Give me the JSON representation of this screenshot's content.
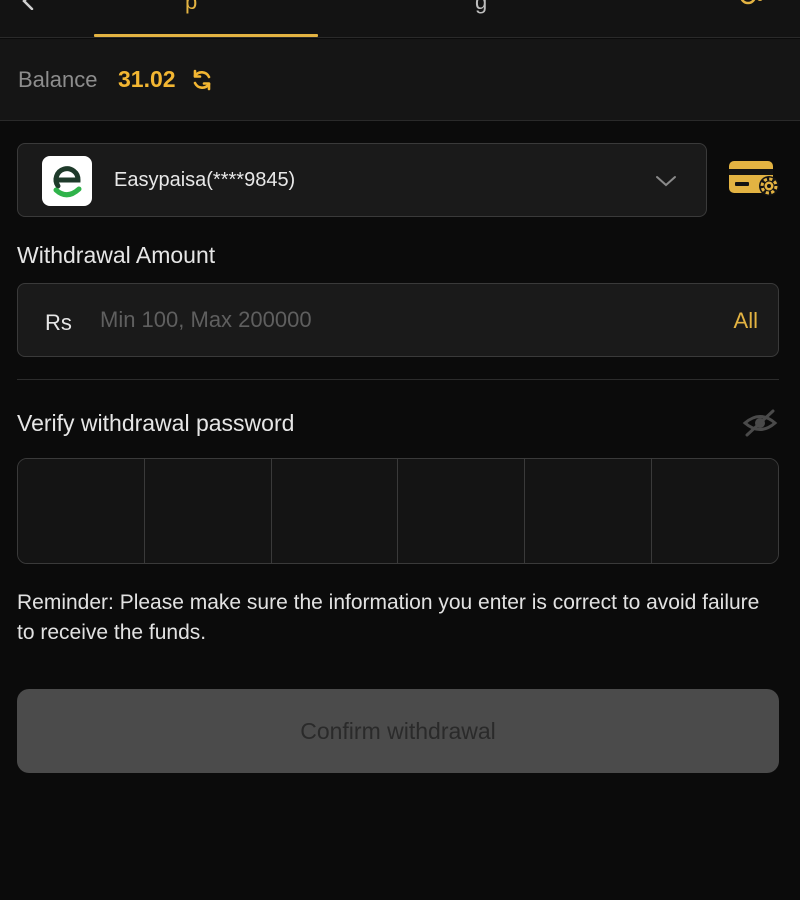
{
  "header": {
    "tab_fragment_left": "p",
    "tab_fragment_right": "g",
    "icons": {
      "back": "chevron-left-icon",
      "record": "record-icon"
    }
  },
  "balance": {
    "label": "Balance",
    "value": "31.02",
    "icon": "refresh-icon"
  },
  "account": {
    "name": "Easypaisa(****9845)",
    "logo": "easypaisa-logo",
    "logo_colors": {
      "green": "#2fb34a",
      "dark": "#1e3a2a"
    },
    "settings_icon": "card-settings-icon"
  },
  "amount": {
    "title": "Withdrawal Amount",
    "currency": "Rs",
    "value": "",
    "placeholder": "Min 100, Max 200000",
    "all_label": "All"
  },
  "password": {
    "title": "Verify withdrawal password",
    "icon": "eye-off-icon",
    "cells": [
      "",
      "",
      "",
      "",
      "",
      ""
    ]
  },
  "reminder": "Reminder: Please make sure the information you enter is correct to avoid failure to receive the funds.",
  "confirm_label": "Confirm withdrawal",
  "colors": {
    "accent": "#e3b342",
    "balance": "#f2b632",
    "background": "#0b0b0b",
    "disabled_button": "#4b4b4b"
  }
}
